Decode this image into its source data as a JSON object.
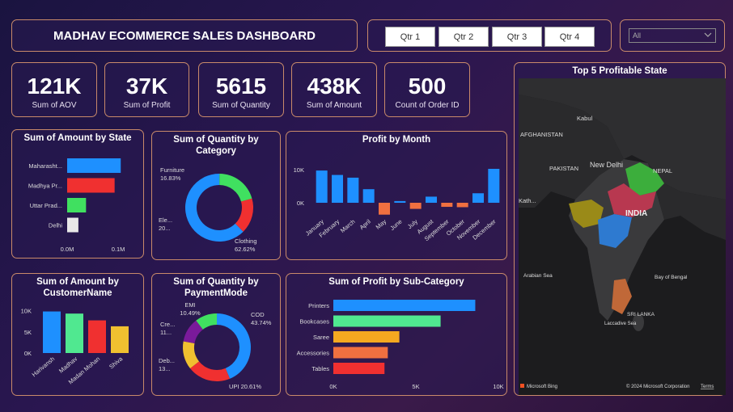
{
  "header": {
    "title": "MADHAV ECOMMERCE SALES DASHBOARD"
  },
  "quarters": [
    "Qtr 1",
    "Qtr 2",
    "Qtr 3",
    "Qtr 4"
  ],
  "filter": {
    "value": "All"
  },
  "kpis": [
    {
      "value": "121K",
      "label": "Sum of AOV"
    },
    {
      "value": "37K",
      "label": "Sum of Profit"
    },
    {
      "value": "5615",
      "label": "Sum of Quantity"
    },
    {
      "value": "438K",
      "label": "Sum of Amount"
    },
    {
      "value": "500",
      "label": "Count of Order ID"
    }
  ],
  "colors": {
    "blue": "#1e90ff",
    "red": "#f03030",
    "green": "#40e060",
    "gray": "#e8e8e8",
    "orange": "#f07040",
    "yellow": "#f0c030",
    "purple": "#7a1a9a",
    "mint": "#50e890",
    "gold": "#f5a820"
  },
  "chart_data": [
    {
      "id": "amount_by_state",
      "type": "bar",
      "orientation": "horizontal",
      "title": "Sum of Amount by State",
      "categories": [
        "Maharasht...",
        "Madhya Pr...",
        "Uttar Prad...",
        "Delhi"
      ],
      "values": [
        0.105,
        0.093,
        0.037,
        0.022
      ],
      "xlim": [
        0,
        0.13
      ],
      "xticks": [
        "0.0M",
        "0.1M"
      ],
      "colors": [
        "#1e90ff",
        "#f03030",
        "#40e060",
        "#e8e8e8"
      ]
    },
    {
      "id": "quantity_by_category",
      "type": "pie",
      "donut": true,
      "title": "Sum of Quantity by Category",
      "labels": [
        "Clothing",
        "Electronics",
        "Furniture"
      ],
      "values": [
        62.62,
        20.55,
        16.83
      ],
      "display_labels": [
        "Clothing\n62.62%",
        "Ele...\n20...",
        "Furniture\n16.83%"
      ],
      "colors": [
        "#1e90ff",
        "#40e060",
        "#f03030"
      ]
    },
    {
      "id": "profit_by_month",
      "type": "bar",
      "title": "Profit by Month",
      "categories": [
        "January",
        "February",
        "March",
        "April",
        "May",
        "June",
        "July",
        "August",
        "September",
        "October",
        "November",
        "December"
      ],
      "values": [
        9500,
        8200,
        7400,
        4000,
        -3500,
        500,
        -1800,
        1800,
        -1200,
        -1300,
        2800,
        10000
      ],
      "ylim": [
        -5000,
        12000
      ],
      "yticks": [
        "0K",
        "10K"
      ],
      "pos_color": "#1e90ff",
      "neg_color": "#f07040"
    },
    {
      "id": "amount_by_customer",
      "type": "bar",
      "title": "Sum of Amount by CustomerName",
      "categories": [
        "Harivansh",
        "Madhav",
        "Madan Mohan",
        "Shiva"
      ],
      "values": [
        9800,
        9300,
        7700,
        6300
      ],
      "ylim": [
        0,
        12000
      ],
      "yticks": [
        "0K",
        "5K",
        "10K"
      ],
      "colors": [
        "#1e90ff",
        "#50e890",
        "#f03030",
        "#f0c030"
      ]
    },
    {
      "id": "quantity_by_paymentmode",
      "type": "pie",
      "donut": true,
      "title": "Sum of Quantity by PaymentMode",
      "labels": [
        "COD",
        "UPI",
        "Debit Card",
        "Credit Card",
        "EMI"
      ],
      "values": [
        43.74,
        20.61,
        13.5,
        11.66,
        10.49
      ],
      "display_labels": [
        "COD\n43.74%",
        "UPI 20.61%",
        "Deb...\n13...",
        "Cre...\n11...",
        "EMI\n10.49%"
      ],
      "colors": [
        "#1e90ff",
        "#f03030",
        "#f0c030",
        "#7a1a9a",
        "#40e060"
      ]
    },
    {
      "id": "profit_by_subcategory",
      "type": "bar",
      "orientation": "horizontal",
      "title": "Sum of Profit by Sub-Category",
      "categories": [
        "Printers",
        "Bookcases",
        "Saree",
        "Accessories",
        "Tables"
      ],
      "values": [
        8600,
        6500,
        4000,
        3300,
        3100
      ],
      "xlim": [
        0,
        10000
      ],
      "xticks": [
        "0K",
        "5K",
        "10K"
      ],
      "colors": [
        "#1e90ff",
        "#50e890",
        "#f5a820",
        "#f07040",
        "#f03030"
      ]
    }
  ],
  "map": {
    "title": "Top 5 Profitable State",
    "labels": [
      "Kabul",
      "AFGHANISTAN",
      "PAKISTAN",
      "New Delhi",
      "NEPAL",
      "INDIA",
      "Arabian Sea",
      "Bay of Bengal",
      "SRI LANKA",
      "Laccadive Sea",
      "Kath..."
    ],
    "footer_left": "Microsoft Bing",
    "footer_right": "© 2024 Microsoft Corporation",
    "footer_terms": "Terms"
  }
}
